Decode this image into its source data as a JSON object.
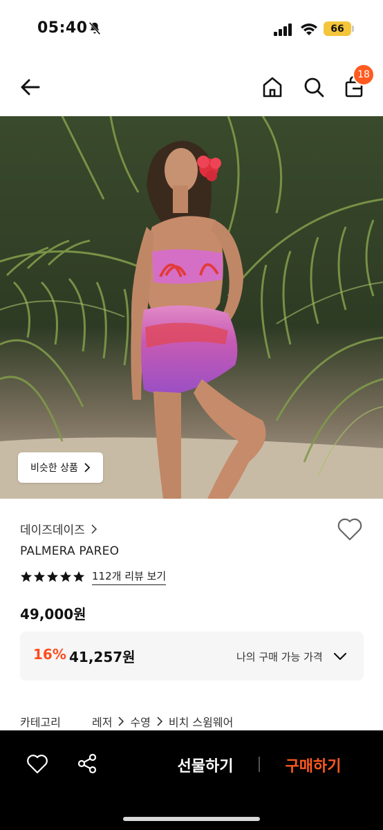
{
  "status_bar": {
    "time": "05:40",
    "battery": "66"
  },
  "header": {
    "cart_count": "18"
  },
  "product_image": {
    "similar_button_label": "비슷한 상품"
  },
  "product": {
    "brand": "데이즈데이즈",
    "name": "PALMERA PAREO",
    "rating_stars": 5,
    "review_link": "112개 리뷰 보기",
    "price": "49,000원",
    "discount": {
      "rate": "16%",
      "price": "41,257원",
      "my_price_label": "나의 구매 가능 가격"
    },
    "category": {
      "label": "카테고리",
      "path": [
        "레저",
        "수영",
        "비치 스윔웨어"
      ]
    }
  },
  "bottom_bar": {
    "gift_label": "선물하기",
    "buy_label": "구매하기"
  },
  "colors": {
    "accent": "#ff5a1f",
    "discount": "#ff4b1f",
    "battery": "#f4c53a"
  }
}
